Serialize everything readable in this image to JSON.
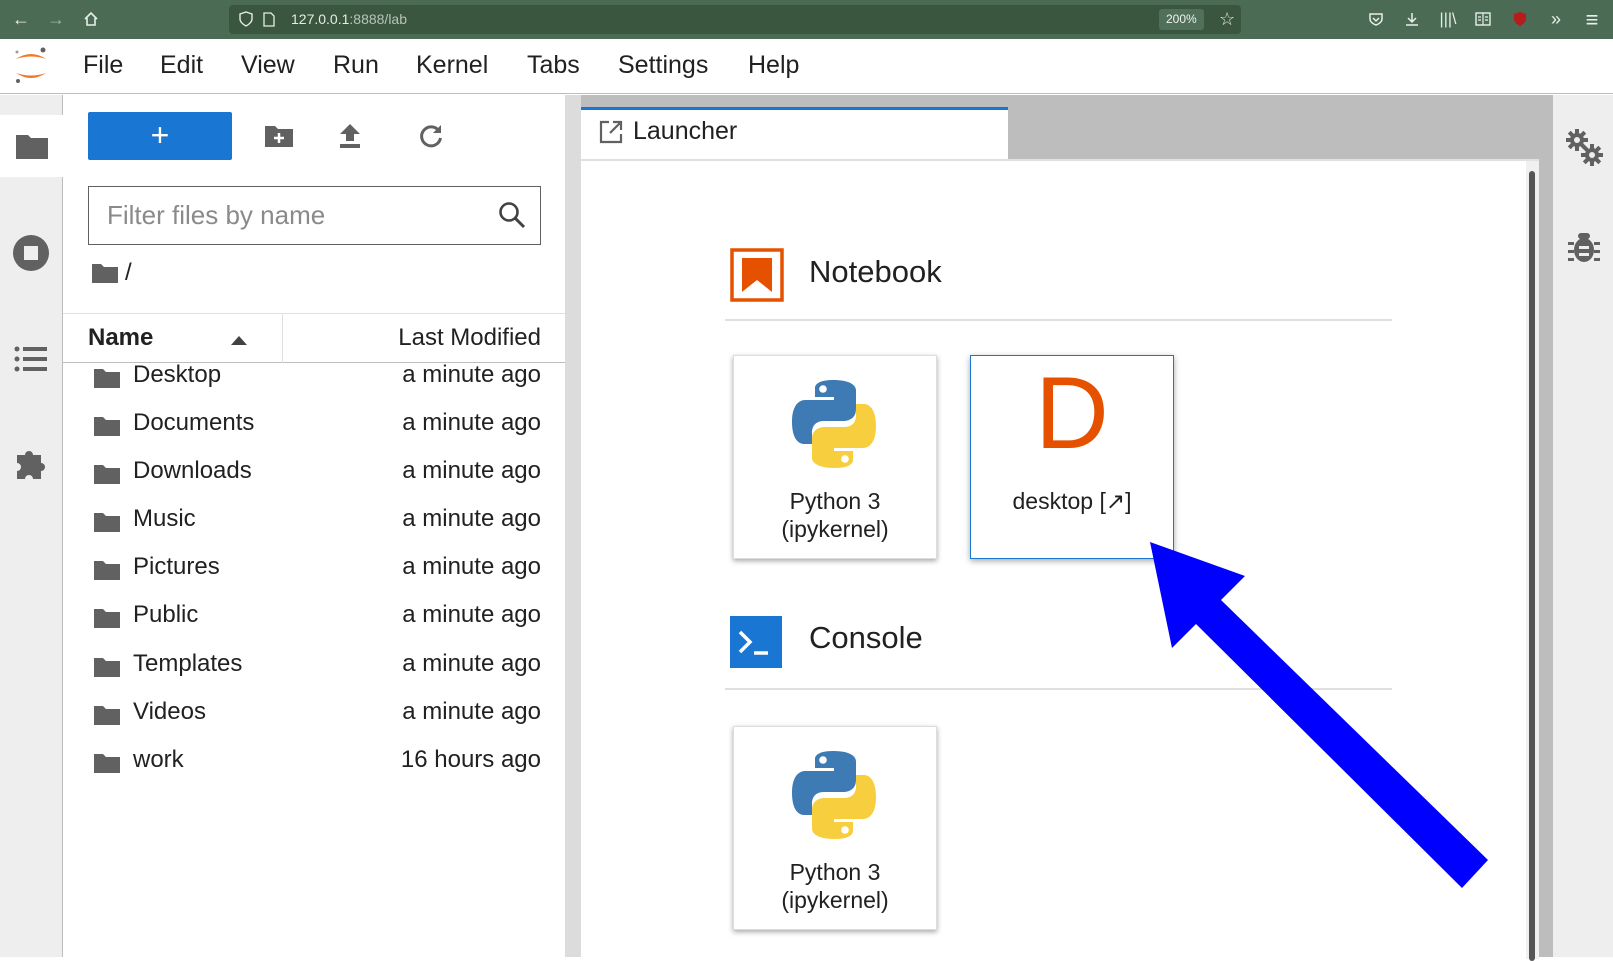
{
  "browser": {
    "url_host": "127.0.0.1",
    "url_rest": ":8888/lab",
    "zoom": "200%"
  },
  "menubar": {
    "items": [
      "File",
      "Edit",
      "View",
      "Run",
      "Kernel",
      "Tabs",
      "Settings",
      "Help"
    ]
  },
  "filebrowser": {
    "new_label": "+",
    "filter_placeholder": "Filter files by name",
    "path": "/",
    "columns": {
      "name": "Name",
      "modified": "Last Modified"
    },
    "files": [
      {
        "name": "Desktop",
        "modified": "a minute ago"
      },
      {
        "name": "Documents",
        "modified": "a minute ago"
      },
      {
        "name": "Downloads",
        "modified": "a minute ago"
      },
      {
        "name": "Music",
        "modified": "a minute ago"
      },
      {
        "name": "Pictures",
        "modified": "a minute ago"
      },
      {
        "name": "Public",
        "modified": "a minute ago"
      },
      {
        "name": "Templates",
        "modified": "a minute ago"
      },
      {
        "name": "Videos",
        "modified": "a minute ago"
      },
      {
        "name": "work",
        "modified": "16 hours ago"
      }
    ]
  },
  "launcher": {
    "tab_title": "Launcher",
    "notebook": {
      "title": "Notebook",
      "cards": [
        {
          "line1": "Python 3",
          "line2": "(ipykernel)"
        },
        {
          "letter": "D",
          "line1": "desktop [↗]"
        }
      ]
    },
    "console": {
      "title": "Console",
      "cards": [
        {
          "line1": "Python 3",
          "line2": "(ipykernel)"
        }
      ]
    }
  },
  "colors": {
    "accent": "#1976d2",
    "notebook_orange": "#e65100",
    "annotation_arrow": "#0000ff",
    "browser_bar": "#4b6b54"
  }
}
